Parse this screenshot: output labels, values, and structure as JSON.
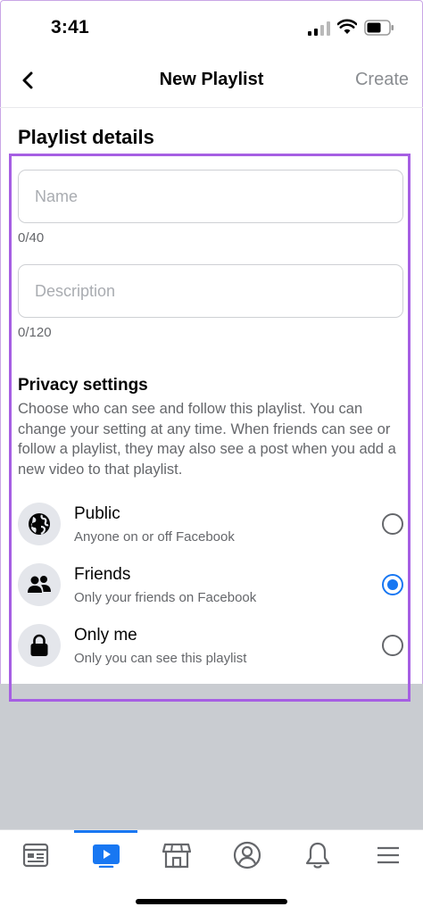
{
  "status_bar": {
    "time": "3:41"
  },
  "nav": {
    "title": "New Playlist",
    "create_label": "Create"
  },
  "section_title": "Playlist details",
  "name_field": {
    "placeholder": "Name",
    "value": "",
    "counter": "0/40"
  },
  "description_field": {
    "placeholder": "Description",
    "value": "",
    "counter": "0/120"
  },
  "privacy": {
    "title": "Privacy settings",
    "description": "Choose who can see and follow this playlist. You can change your setting at any time. When friends can see or follow a playlist, they may also see a post when you add a new video to that playlist.",
    "options": [
      {
        "label": "Public",
        "sublabel": "Anyone on or off Facebook",
        "icon": "globe-icon",
        "selected": false
      },
      {
        "label": "Friends",
        "sublabel": "Only your friends on Facebook",
        "icon": "friends-icon",
        "selected": true
      },
      {
        "label": "Only me",
        "sublabel": "Only you can see this playlist",
        "icon": "lock-icon",
        "selected": false
      }
    ]
  },
  "tabs": [
    {
      "icon": "news-feed-icon",
      "active": false
    },
    {
      "icon": "watch-icon",
      "active": true
    },
    {
      "icon": "marketplace-icon",
      "active": false
    },
    {
      "icon": "profile-icon",
      "active": false
    },
    {
      "icon": "bell-icon",
      "active": false
    },
    {
      "icon": "menu-icon",
      "active": false
    }
  ],
  "colors": {
    "accent": "#1877f2",
    "highlight_box": "#a65fe3",
    "secondary_text": "#65676b",
    "overlay_gray": "#c9ccd1"
  }
}
